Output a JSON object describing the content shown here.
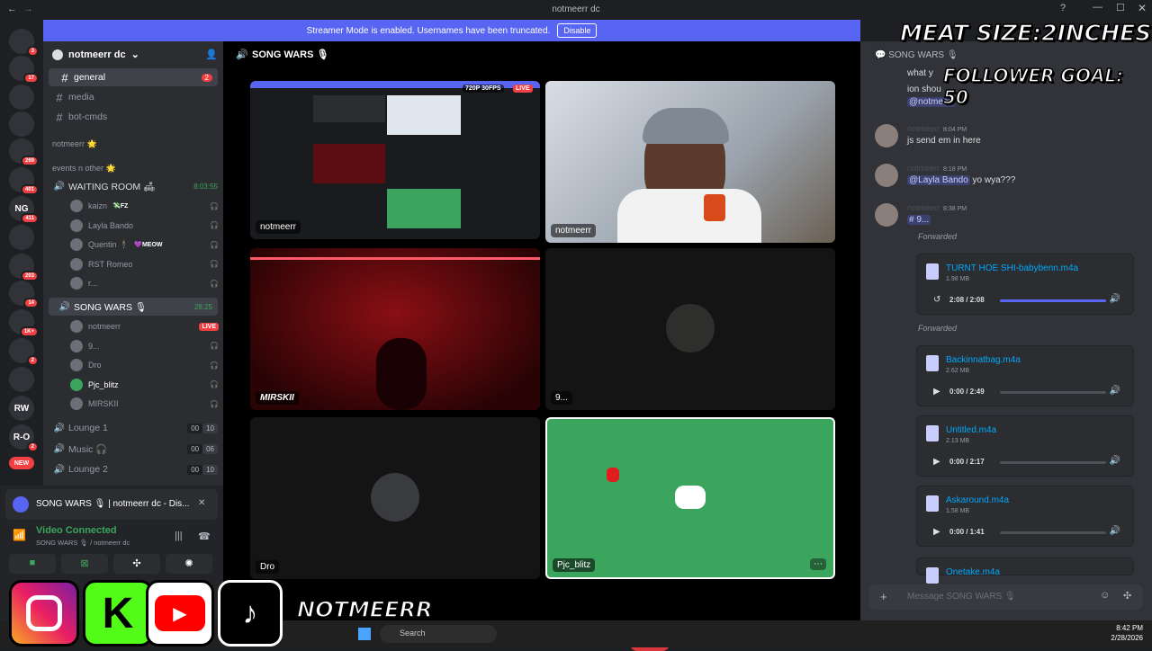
{
  "window": {
    "title": "notmeerr dc"
  },
  "banner": {
    "text": "Streamer Mode is enabled. Usernames have been truncated.",
    "button": "Disable"
  },
  "servers": [
    {
      "label": "",
      "badge": "3"
    },
    {
      "label": "",
      "badge": "17"
    },
    {
      "label": "",
      "badge": ""
    },
    {
      "label": "",
      "badge": ""
    },
    {
      "label": "",
      "badge": "269"
    },
    {
      "label": "",
      "badge": "401"
    },
    {
      "label": "NG",
      "badge": "411"
    },
    {
      "label": "",
      "badge": ""
    },
    {
      "label": "",
      "badge": "203"
    },
    {
      "label": "",
      "badge": "14"
    },
    {
      "label": "",
      "badge": "1K+"
    },
    {
      "label": "",
      "badge": "2"
    },
    {
      "label": "",
      "badge": ""
    },
    {
      "label": "RW",
      "badge": ""
    },
    {
      "label": "R-O",
      "badge": "2"
    },
    {
      "label": "NEW",
      "badge": ""
    }
  ],
  "sidebar": {
    "server_name": "notmeerr dc",
    "channels": [
      {
        "name": "general",
        "badge": "2"
      },
      {
        "name": "media",
        "badge": ""
      },
      {
        "name": "bot-cmds",
        "badge": ""
      }
    ],
    "category1": "notmeerr 🌟",
    "category2": "events n other 🌟",
    "waiting_room": {
      "name": "WAITING ROOM 🛋",
      "time": "8:03:55"
    },
    "waiting_users": [
      {
        "name": "kaizn",
        "tag": "💸FZ"
      },
      {
        "name": "Layla Bando",
        "tag": ""
      },
      {
        "name": "Quentin 🕴",
        "tag": "💜MEOW"
      },
      {
        "name": "RST Romeo",
        "tag": ""
      },
      {
        "name": "r...",
        "tag": ""
      }
    ],
    "song_wars": {
      "name": "SONG WARS 🎙",
      "time": "28:25"
    },
    "song_users": [
      {
        "name": "notmeerr",
        "live": "LIVE"
      },
      {
        "name": "9...",
        "live": ""
      },
      {
        "name": "Dro",
        "live": ""
      },
      {
        "name": "Pjc_blitz",
        "live": ""
      },
      {
        "name": "MIRSKII",
        "live": ""
      }
    ],
    "lounges": [
      {
        "name": "Lounge 1",
        "c1": "00",
        "c2": "10"
      },
      {
        "name": "Music 🎧",
        "c1": "00",
        "c2": "06"
      },
      {
        "name": "Lounge 2",
        "c1": "00",
        "c2": "10"
      }
    ]
  },
  "voice_panel": {
    "activity": "SONG WARS 🎙 | notmeerr dc - Dis...",
    "status": "Video Connected",
    "channel": "SONG WARS 🎙 / notmeerr dc"
  },
  "main": {
    "header": "SONG WARS 🎙",
    "tiles": [
      {
        "name": "notmeerr",
        "badge": "720P 30FPS",
        "live": "LIVE"
      },
      {
        "name": "notmeerr"
      },
      {
        "name": "MIRSKII"
      },
      {
        "name": "9..."
      },
      {
        "name": "Dro"
      },
      {
        "name": "Pjc_blitz"
      }
    ]
  },
  "chat": {
    "header": "SONG WARS 🎙",
    "partial": [
      "what y",
      "ion shou"
    ],
    "mention_top": "@notmeerr",
    "messages": [
      {
        "author": "notmeerr",
        "time": "8:04 PM",
        "text": "js send em in here"
      },
      {
        "author": "notmeerr",
        "time": "8:18 PM",
        "mention": "@Layla Bando",
        "text": " yo wya???"
      },
      {
        "author": "notmeerr",
        "time": "8:38 PM",
        "text": "# 9..."
      }
    ],
    "forwarded_label": "Forwarded",
    "attachments": [
      {
        "name": "TURNT HOE SHI-babybenn.m4a",
        "size": "1.98 MB",
        "time": "2:08 / 2:08",
        "progress": 1.0
      },
      {
        "name": "Backinnatbag.m4a",
        "size": "2.62 MB",
        "time": "0:00 / 2:49",
        "progress": 0.0
      },
      {
        "name": "Untitled.m4a",
        "size": "2.13 MB",
        "time": "0:00 / 2:17",
        "progress": 0.0
      },
      {
        "name": "Askaround.m4a",
        "size": "1.58 MB",
        "time": "0:00 / 1:41",
        "progress": 0.0
      },
      {
        "name": "Onetake.m4a",
        "size": "",
        "time": "",
        "progress": 0.0
      }
    ],
    "input_placeholder": "Message SONG WARS 🎙"
  },
  "overlay": {
    "meat": "MEAT SIZE:2INCHES",
    "goal": "FOLLOWER GOAL: 50",
    "handle": "NOTMEERR"
  },
  "taskbar": {
    "search": "Search",
    "time": "8:42 PM",
    "date": "2/28/2026"
  },
  "colors": {
    "blurple": "#5865f2",
    "green": "#3ba55d",
    "red": "#da373c",
    "live": "#f23f43"
  }
}
